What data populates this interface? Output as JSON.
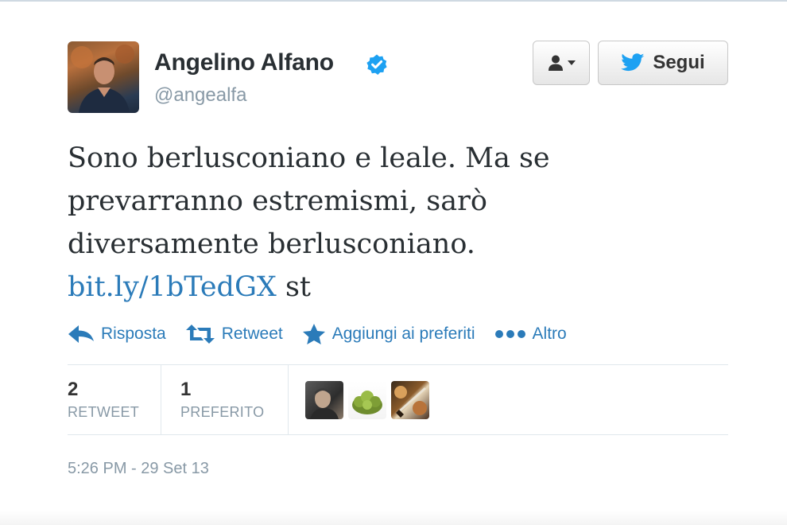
{
  "user": {
    "name": "Angelino Alfano",
    "handle": "@angealfa",
    "verified": true
  },
  "header": {
    "follow_label": "Segui",
    "user_menu_icon": "user-dropdown-icon"
  },
  "tweet": {
    "text_before_link": "Sono berlusconiano e leale. Ma se prevarranno estremismi, sarò diversamente berlusconiano. ",
    "link_text": "bit.ly/1bTedGX",
    "text_after_link": " st"
  },
  "actions": {
    "reply": "Risposta",
    "retweet": "Retweet",
    "favorite": "Aggiungi ai preferiti",
    "more": "Altro"
  },
  "stats": {
    "retweets_count": "2",
    "retweets_label": "RETWEET",
    "favorites_count": "1",
    "favorites_label": "PREFERITO"
  },
  "timestamp": "5:26 PM - 29 Set 13",
  "colors": {
    "link": "#2b7bb9",
    "verified": "#1da1f2",
    "muted": "#8899a6",
    "text": "#292f33"
  }
}
